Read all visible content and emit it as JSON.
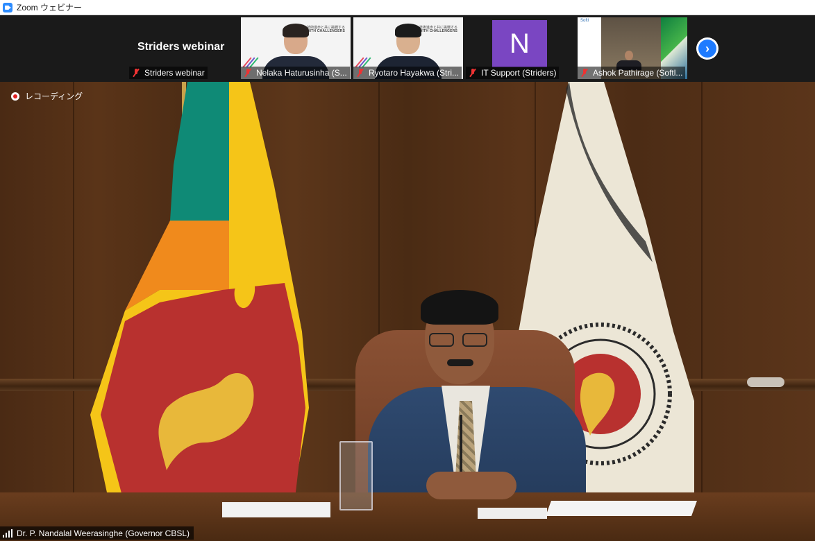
{
  "window": {
    "title": "Zoom ウェビナー",
    "app_icon": "zoom-camera-icon"
  },
  "gallery": {
    "tiles": [
      {
        "display_text": "Striders webinar",
        "name": "Striders webinar",
        "muted": true
      },
      {
        "name": "Nelaka Haturusinha (S...",
        "slide_line1": "技術進歩と共に挑戦する",
        "slide_line2": "STRIDE WITH CHALLENGERS",
        "muted": true
      },
      {
        "name": "Ryotaro Hayakwa (Stri...",
        "slide_line1": "技術進歩と共に挑戦する",
        "slide_line2": "STRIDE WITH CHALLENGERS",
        "muted": true
      },
      {
        "name": "IT Support (Striders)",
        "avatar_letter": "N",
        "avatar_color": "#7a46c2",
        "muted": true
      },
      {
        "name": "Ashok Pathirage (Softl...",
        "logo_text": "Softl",
        "muted": true
      }
    ],
    "next_icon": "chevron-right-icon",
    "next_glyph": "›"
  },
  "recording": {
    "label": "レコーディング",
    "icon": "record-dot-icon"
  },
  "speaker": {
    "name": "Dr. P. Nandalal Weerasinghe (Governor CBSL)",
    "icon": "signal-bars-icon"
  },
  "colors": {
    "accent": "#2d8cff",
    "muted_mic": "#ee3333",
    "next_button": "#1e7bff"
  }
}
